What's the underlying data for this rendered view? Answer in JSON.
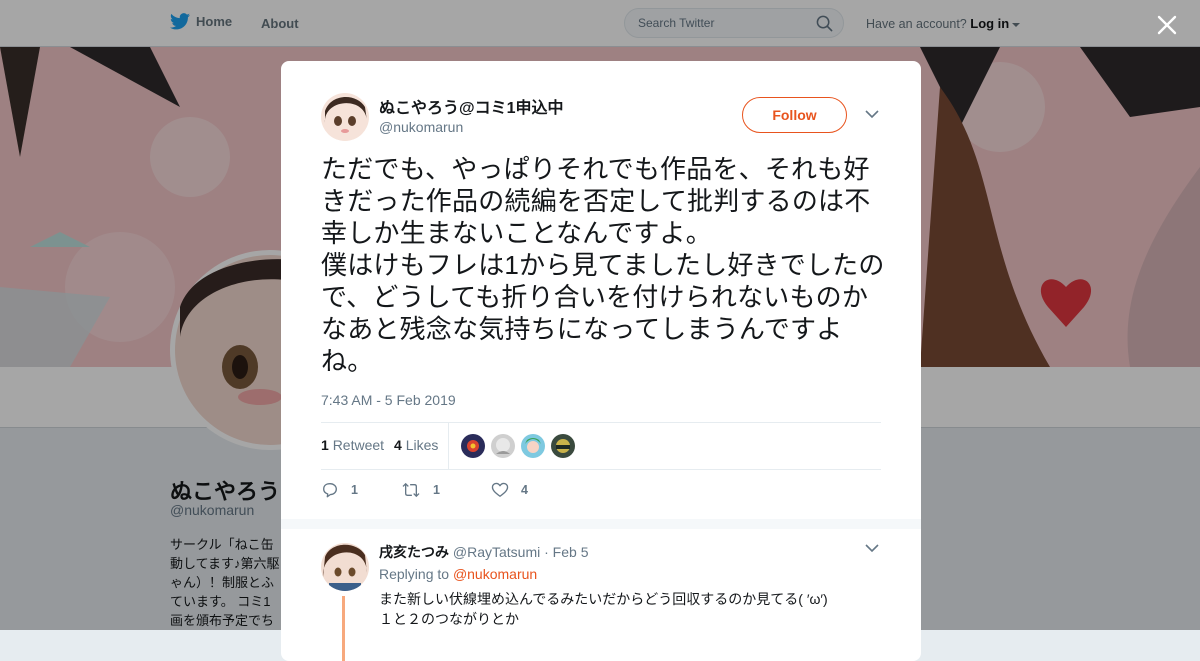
{
  "nav": {
    "home_label": "Home",
    "about_label": "About",
    "search_placeholder": "Search Twitter",
    "account_prompt": "Have an account?",
    "login_label": "Log in"
  },
  "background_profile": {
    "name": "ぬこやろう",
    "handle": "@nukomarun",
    "bio_lines": [
      "サークル「ねこ缶",
      "動してます♪第六駆",
      "ゃん）！制服とふ",
      "ています。 コミ1",
      "画を頒布予定でち"
    ]
  },
  "tweet": {
    "display_name": "ぬこやろう@コミ1申込中",
    "handle": "@nukomarun",
    "follow_label": "Follow",
    "text": "ただでも、やっぱりそれでも作品を、それも好きだった作品の続編を否定して批判するのは不幸しか生まないことなんですよ。\n僕はけもフレは1から見てましたし好きでしたので、どうしても折り合いを付けられないものかなあと残念な気持ちになってしまうんですよね。",
    "timestamp": "7:43 AM - 5 Feb 2019",
    "retweet_count": "1",
    "retweet_label": "Retweet",
    "like_count": "4",
    "like_label": "Likes",
    "actions": {
      "reply_count": "1",
      "retweet_count": "1",
      "like_count": "4"
    }
  },
  "reply": {
    "name": "戌亥たつみ",
    "handle": "@RayTatsumi",
    "date": "· Feb 5",
    "replying_prefix": "Replying to",
    "replying_to": "@nukomarun",
    "text": "また新しい伏線埋め込んでるみたいだからどう回収するのか見てる( ′ω′)\n１と２のつながりとか"
  },
  "colors": {
    "accent": "#e8541e",
    "twitter_blue": "#1da1f2",
    "muted": "#657786"
  }
}
